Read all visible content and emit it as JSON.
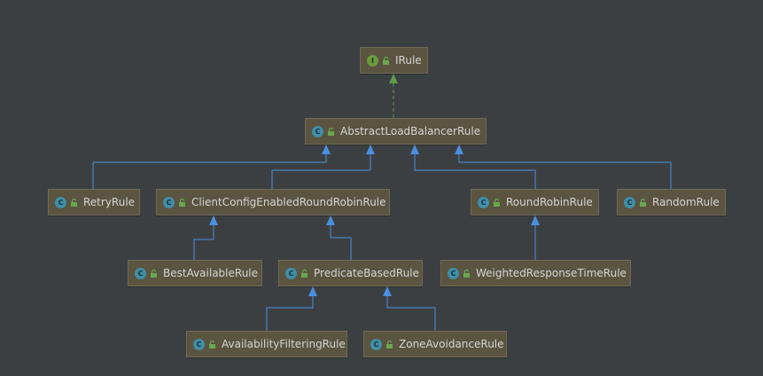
{
  "colors": {
    "background": "#3c3f41",
    "extends_edge": "#4a90e2",
    "implements_edge": "#5f9b4a"
  },
  "icons": {
    "class_badge": "C",
    "interface_badge": "I"
  },
  "nodes": [
    {
      "id": "IRule",
      "kind": "interface",
      "label": "IRule"
    },
    {
      "id": "AbstractLoadBalancerRule",
      "kind": "class",
      "label": "AbstractLoadBalancerRule"
    },
    {
      "id": "RetryRule",
      "kind": "class",
      "label": "RetryRule"
    },
    {
      "id": "ClientConfigEnabledRoundRobinRule",
      "kind": "class",
      "label": "ClientConfigEnabledRoundRobinRule"
    },
    {
      "id": "RoundRobinRule",
      "kind": "class",
      "label": "RoundRobinRule"
    },
    {
      "id": "RandomRule",
      "kind": "class",
      "label": "RandomRule"
    },
    {
      "id": "BestAvailableRule",
      "kind": "class",
      "label": "BestAvailableRule"
    },
    {
      "id": "PredicateBasedRule",
      "kind": "class",
      "label": "PredicateBasedRule"
    },
    {
      "id": "WeightedResponseTimeRule",
      "kind": "class",
      "label": "WeightedResponseTimeRule"
    },
    {
      "id": "AvailabilityFilteringRule",
      "kind": "class",
      "label": "AvailabilityFilteringRule"
    },
    {
      "id": "ZoneAvoidanceRule",
      "kind": "class",
      "label": "ZoneAvoidanceRule"
    }
  ],
  "edges": [
    {
      "from": "AbstractLoadBalancerRule",
      "to": "IRule",
      "type": "implements"
    },
    {
      "from": "RetryRule",
      "to": "AbstractLoadBalancerRule",
      "type": "extends"
    },
    {
      "from": "ClientConfigEnabledRoundRobinRule",
      "to": "AbstractLoadBalancerRule",
      "type": "extends"
    },
    {
      "from": "RoundRobinRule",
      "to": "AbstractLoadBalancerRule",
      "type": "extends"
    },
    {
      "from": "RandomRule",
      "to": "AbstractLoadBalancerRule",
      "type": "extends"
    },
    {
      "from": "BestAvailableRule",
      "to": "ClientConfigEnabledRoundRobinRule",
      "type": "extends"
    },
    {
      "from": "PredicateBasedRule",
      "to": "ClientConfigEnabledRoundRobinRule",
      "type": "extends"
    },
    {
      "from": "WeightedResponseTimeRule",
      "to": "RoundRobinRule",
      "type": "extends"
    },
    {
      "from": "AvailabilityFilteringRule",
      "to": "PredicateBasedRule",
      "type": "extends"
    },
    {
      "from": "ZoneAvoidanceRule",
      "to": "PredicateBasedRule",
      "type": "extends"
    }
  ]
}
